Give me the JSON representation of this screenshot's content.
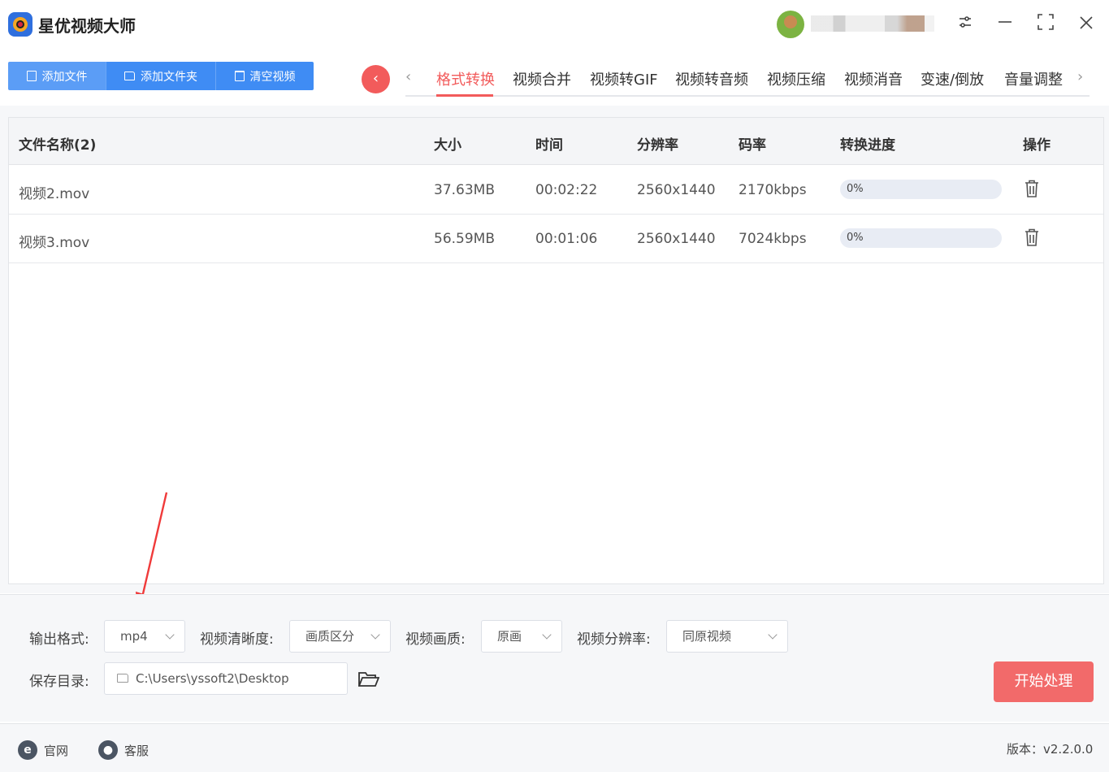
{
  "app": {
    "title": "星优视频大师"
  },
  "toolbar": {
    "add_file": "添加文件",
    "add_folder": "添加文件夹",
    "clear_videos": "清空视频"
  },
  "tabs": [
    {
      "label": "格式转换",
      "active": true
    },
    {
      "label": "视频合并"
    },
    {
      "label": "视频转GIF"
    },
    {
      "label": "视频转音频"
    },
    {
      "label": "视频压缩"
    },
    {
      "label": "视频消音"
    },
    {
      "label": "变速/倒放"
    },
    {
      "label": "音量调整"
    }
  ],
  "table": {
    "headers": {
      "name": "文件名称(2)",
      "size": "大小",
      "time": "时间",
      "resolution": "分辨率",
      "bitrate": "码率",
      "progress": "转换进度",
      "action": "操作"
    },
    "rows": [
      {
        "name": "视频2.mov",
        "size": "37.63MB",
        "time": "00:02:22",
        "resolution": "2560x1440",
        "bitrate": "2170kbps",
        "progress": "0%",
        "progress_value": 0
      },
      {
        "name": "视频3.mov",
        "size": "56.59MB",
        "time": "00:01:06",
        "resolution": "2560x1440",
        "bitrate": "7024kbps",
        "progress": "0%",
        "progress_value": 0
      }
    ]
  },
  "settings": {
    "output_format_label": "输出格式:",
    "output_format_value": "mp4",
    "clarity_label": "视频清晰度:",
    "clarity_value": "画质区分",
    "quality_label": "视频画质:",
    "quality_value": "原画",
    "resolution_label": "视频分辨率:",
    "resolution_value": "同原视频",
    "save_dir_label": "保存目录:",
    "save_dir_value": "C:\\Users\\yssoft2\\Desktop"
  },
  "actions": {
    "start": "开始处理"
  },
  "footer": {
    "website": "官网",
    "support": "客服",
    "version": "版本：v2.2.0.0"
  },
  "colors": {
    "accent_blue": "#3f8cf4",
    "accent_red": "#f25b5b",
    "start_button": "#f26a6a"
  }
}
